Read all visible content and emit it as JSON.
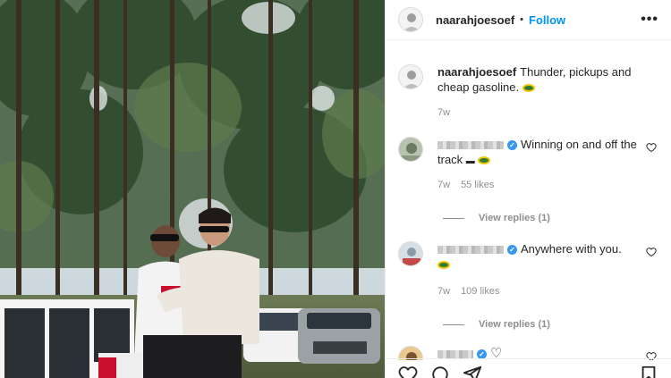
{
  "post": {
    "username": "naarahjoesoef",
    "follow_label": "Follow",
    "separator": "•",
    "more_label": "•••",
    "caption_text": "Thunder, pickups and cheap gasoline.",
    "caption_time": "7w"
  },
  "comments": [
    {
      "text": "Winning on and off the track",
      "emoji_text": "🏎️",
      "time": "7w",
      "likes": "55 likes",
      "view_replies": "View replies (1)"
    },
    {
      "text": "Anywhere with you.",
      "time": "7w",
      "likes": "109 likes",
      "view_replies": "View replies (1)"
    },
    {
      "text": "♡"
    }
  ],
  "icons": {
    "more": "more-options-icon",
    "like": "heart-icon",
    "comment": "comment-icon",
    "share": "share-icon",
    "save": "bookmark-icon",
    "verified": "verified-badge-icon"
  },
  "colors": {
    "accent": "#0095f6",
    "verified": "#3897f0",
    "muted": "#8e8e8e"
  }
}
